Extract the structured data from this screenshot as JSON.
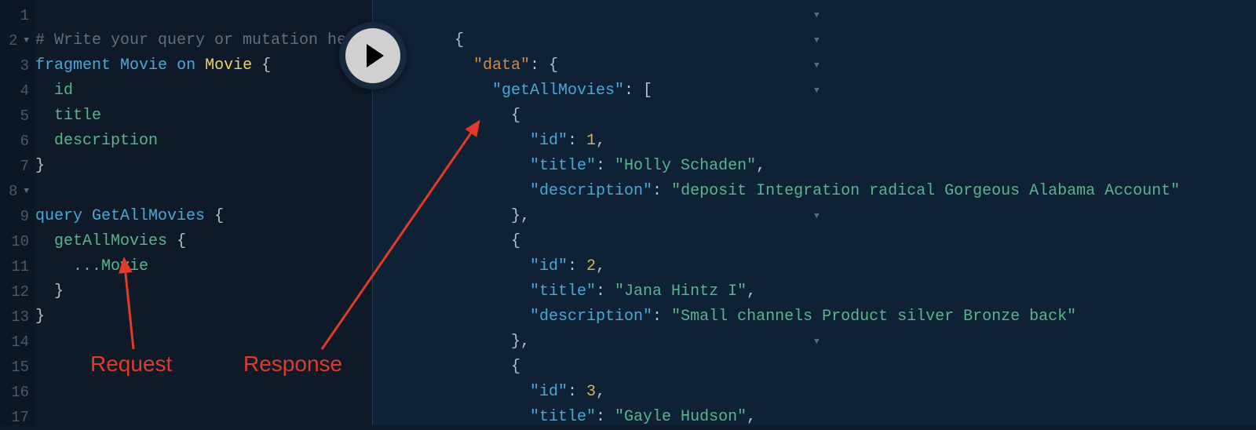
{
  "editor": {
    "comment": "# Write your query or mutation here",
    "fragment_kw": "fragment",
    "fragment_name": "Movie",
    "on_kw": "on",
    "type_name": "Movie",
    "field_id": "id",
    "field_title": "title",
    "field_desc": "description",
    "query_kw": "query",
    "query_name": "GetAllMovies",
    "field_get": "getAllMovies",
    "spread": "...Movie",
    "line_numbers": [
      "1",
      "2",
      "3",
      "4",
      "5",
      "6",
      "7",
      "8",
      "9",
      "10",
      "11",
      "12",
      "13",
      "14",
      "15",
      "16",
      "17"
    ]
  },
  "response": {
    "data_key": "\"data\"",
    "get_key": "\"getAllMovies\"",
    "id_key": "\"id\"",
    "title_key": "\"title\"",
    "desc_key": "\"description\"",
    "movies": [
      {
        "id": 1,
        "title": "\"Holly Schaden\"",
        "description": "\"deposit Integration radical Gorgeous Alabama Account\""
      },
      {
        "id": 2,
        "title": "\"Jana Hintz I\"",
        "description": "\"Small channels Product silver Bronze back\""
      },
      {
        "id": 3,
        "title": "\"Gayle Hudson\"",
        "description": ""
      }
    ]
  },
  "annotations": {
    "request": "Request",
    "response": "Response"
  }
}
